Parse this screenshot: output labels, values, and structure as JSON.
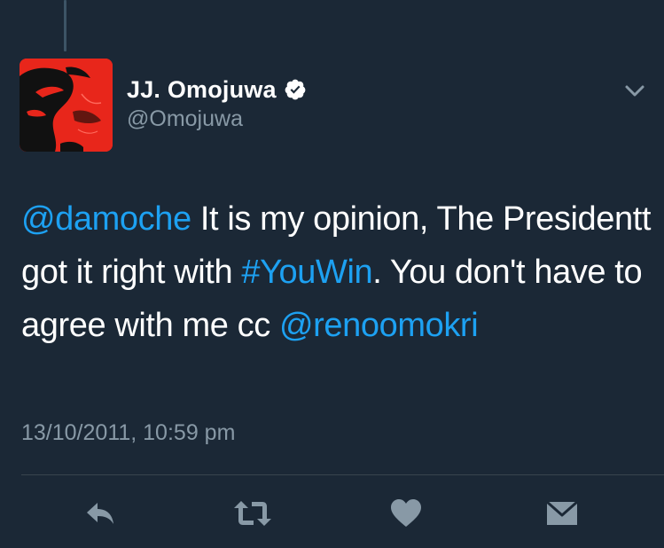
{
  "tweet": {
    "author": {
      "name": "JJ. Omojuwa",
      "handle": "@Omojuwa",
      "verified": true
    },
    "body": {
      "mention_1": "@damoche",
      "text_1": " It is my opinion, The Presidentt got it right with ",
      "hashtag": "#YouWin",
      "text_2": ". You don't have to agree with me cc ",
      "mention_2": "@renoomokri"
    },
    "timestamp": "13/10/2011, 10:59 pm"
  },
  "actions": {
    "reply_icon": "reply-icon",
    "retweet_icon": "retweet-icon",
    "like_icon": "heart-icon",
    "message_icon": "direct-message-icon"
  },
  "colors": {
    "background": "#1b2836",
    "link": "#1da1f2",
    "secondary_text": "#8899a6",
    "icon": "#8899a6",
    "avatar_red": "#e8261b"
  }
}
